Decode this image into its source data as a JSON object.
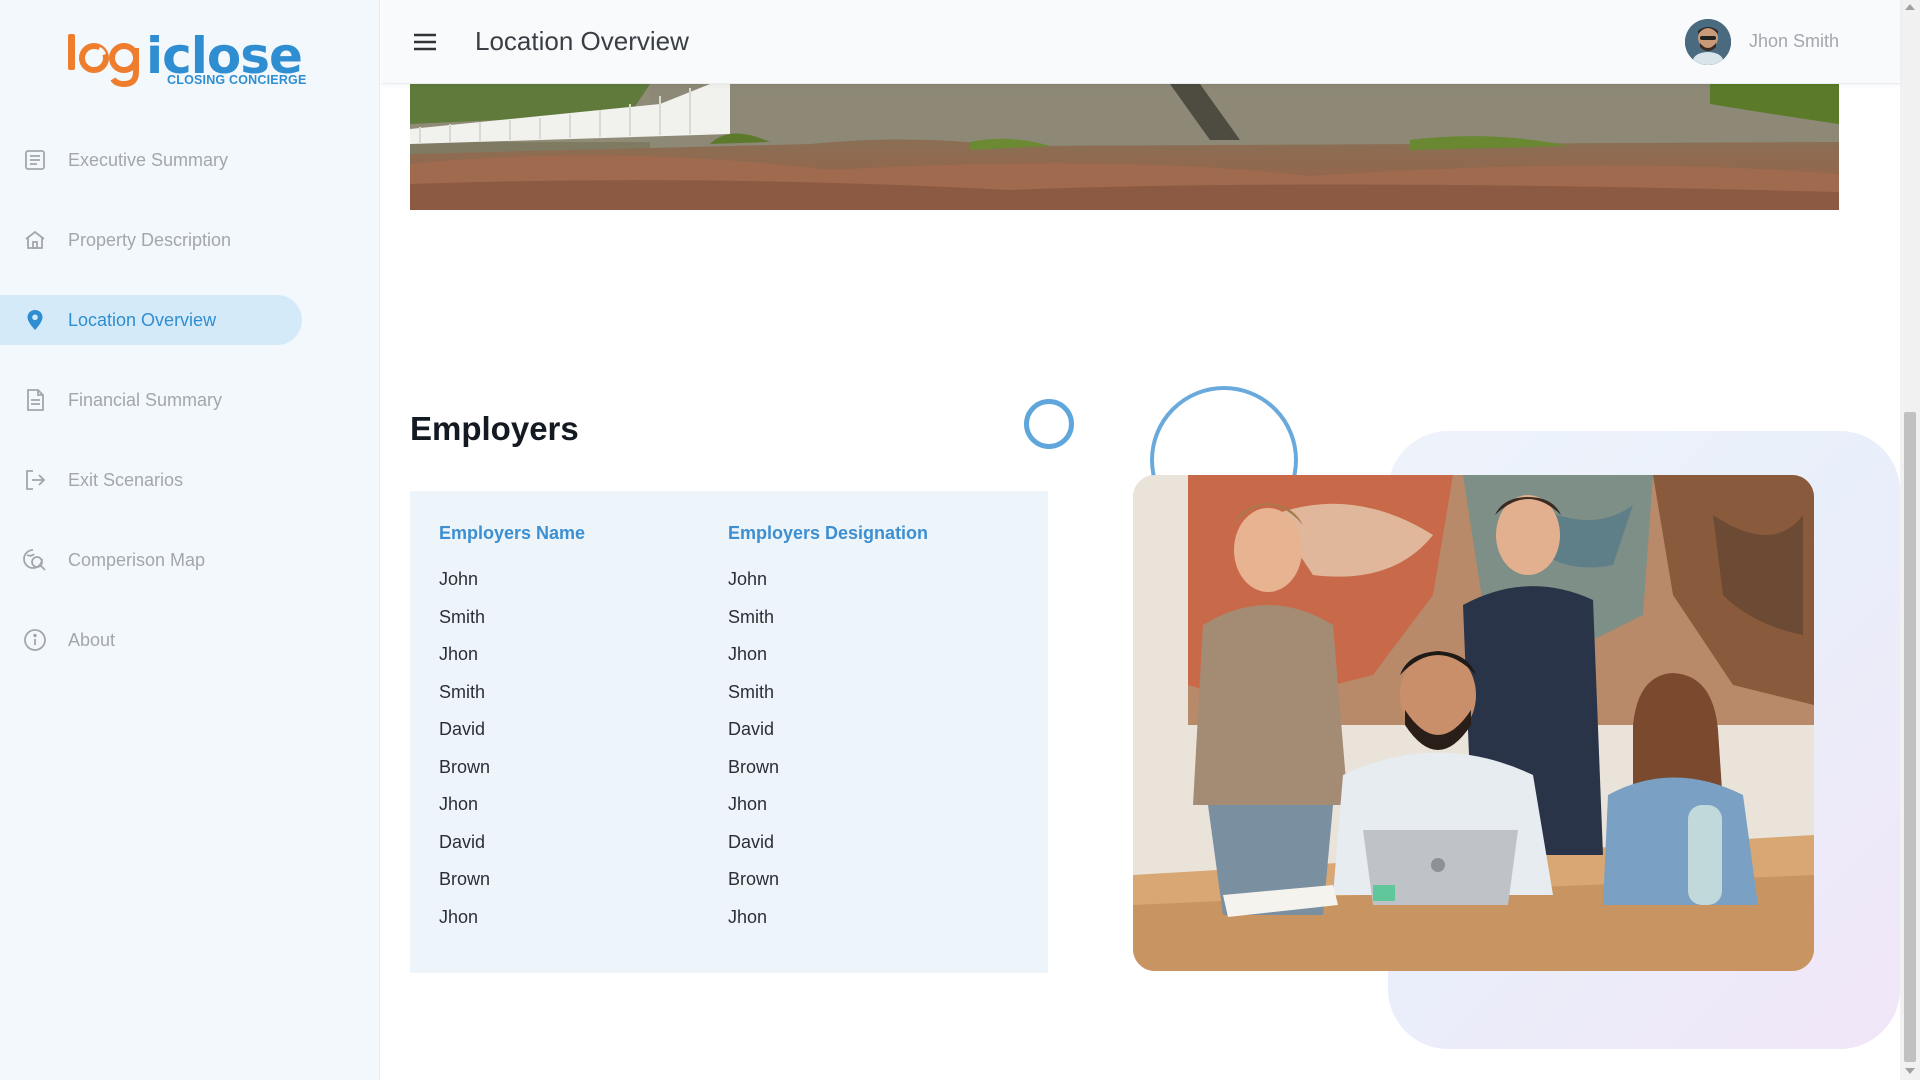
{
  "app": {
    "logo_word_part1": "l",
    "logo_word_part2": "g",
    "logo_word_part3": "iclose",
    "logo_tagline": "CLOSING CONCIERGE",
    "brand_orange": "#ef7d2e",
    "brand_blue": "#2f8ed1"
  },
  "sidebar": {
    "items": [
      {
        "label": "Executive Summary",
        "icon": "document-icon",
        "active": false
      },
      {
        "label": "Property Description",
        "icon": "home-icon",
        "active": false
      },
      {
        "label": "Location Overview",
        "icon": "location-pin-icon",
        "active": true
      },
      {
        "label": "Financial Summary",
        "icon": "document-lines-icon",
        "active": false
      },
      {
        "label": "Exit Scenarios",
        "icon": "exit-icon",
        "active": false
      },
      {
        "label": "Comperison Map",
        "icon": "map-search-icon",
        "active": false
      },
      {
        "label": "About",
        "icon": "info-icon",
        "active": false
      }
    ]
  },
  "header": {
    "title": "Location Overview",
    "user_name": "Jhon Smith",
    "menu_icon": "hamburger-menu-icon"
  },
  "employers": {
    "title": "Employers",
    "columns": [
      "Employers Name",
      "Employers Designation"
    ],
    "names": [
      "John",
      "Smith",
      "Jhon",
      "Smith",
      "David",
      "Brown",
      "Jhon",
      "David",
      "Brown",
      "Jhon"
    ],
    "designations": [
      "John",
      "Smith",
      "Jhon",
      "Smith",
      "David",
      "Brown",
      "Jhon",
      "David",
      "Brown",
      "Jhon"
    ]
  }
}
